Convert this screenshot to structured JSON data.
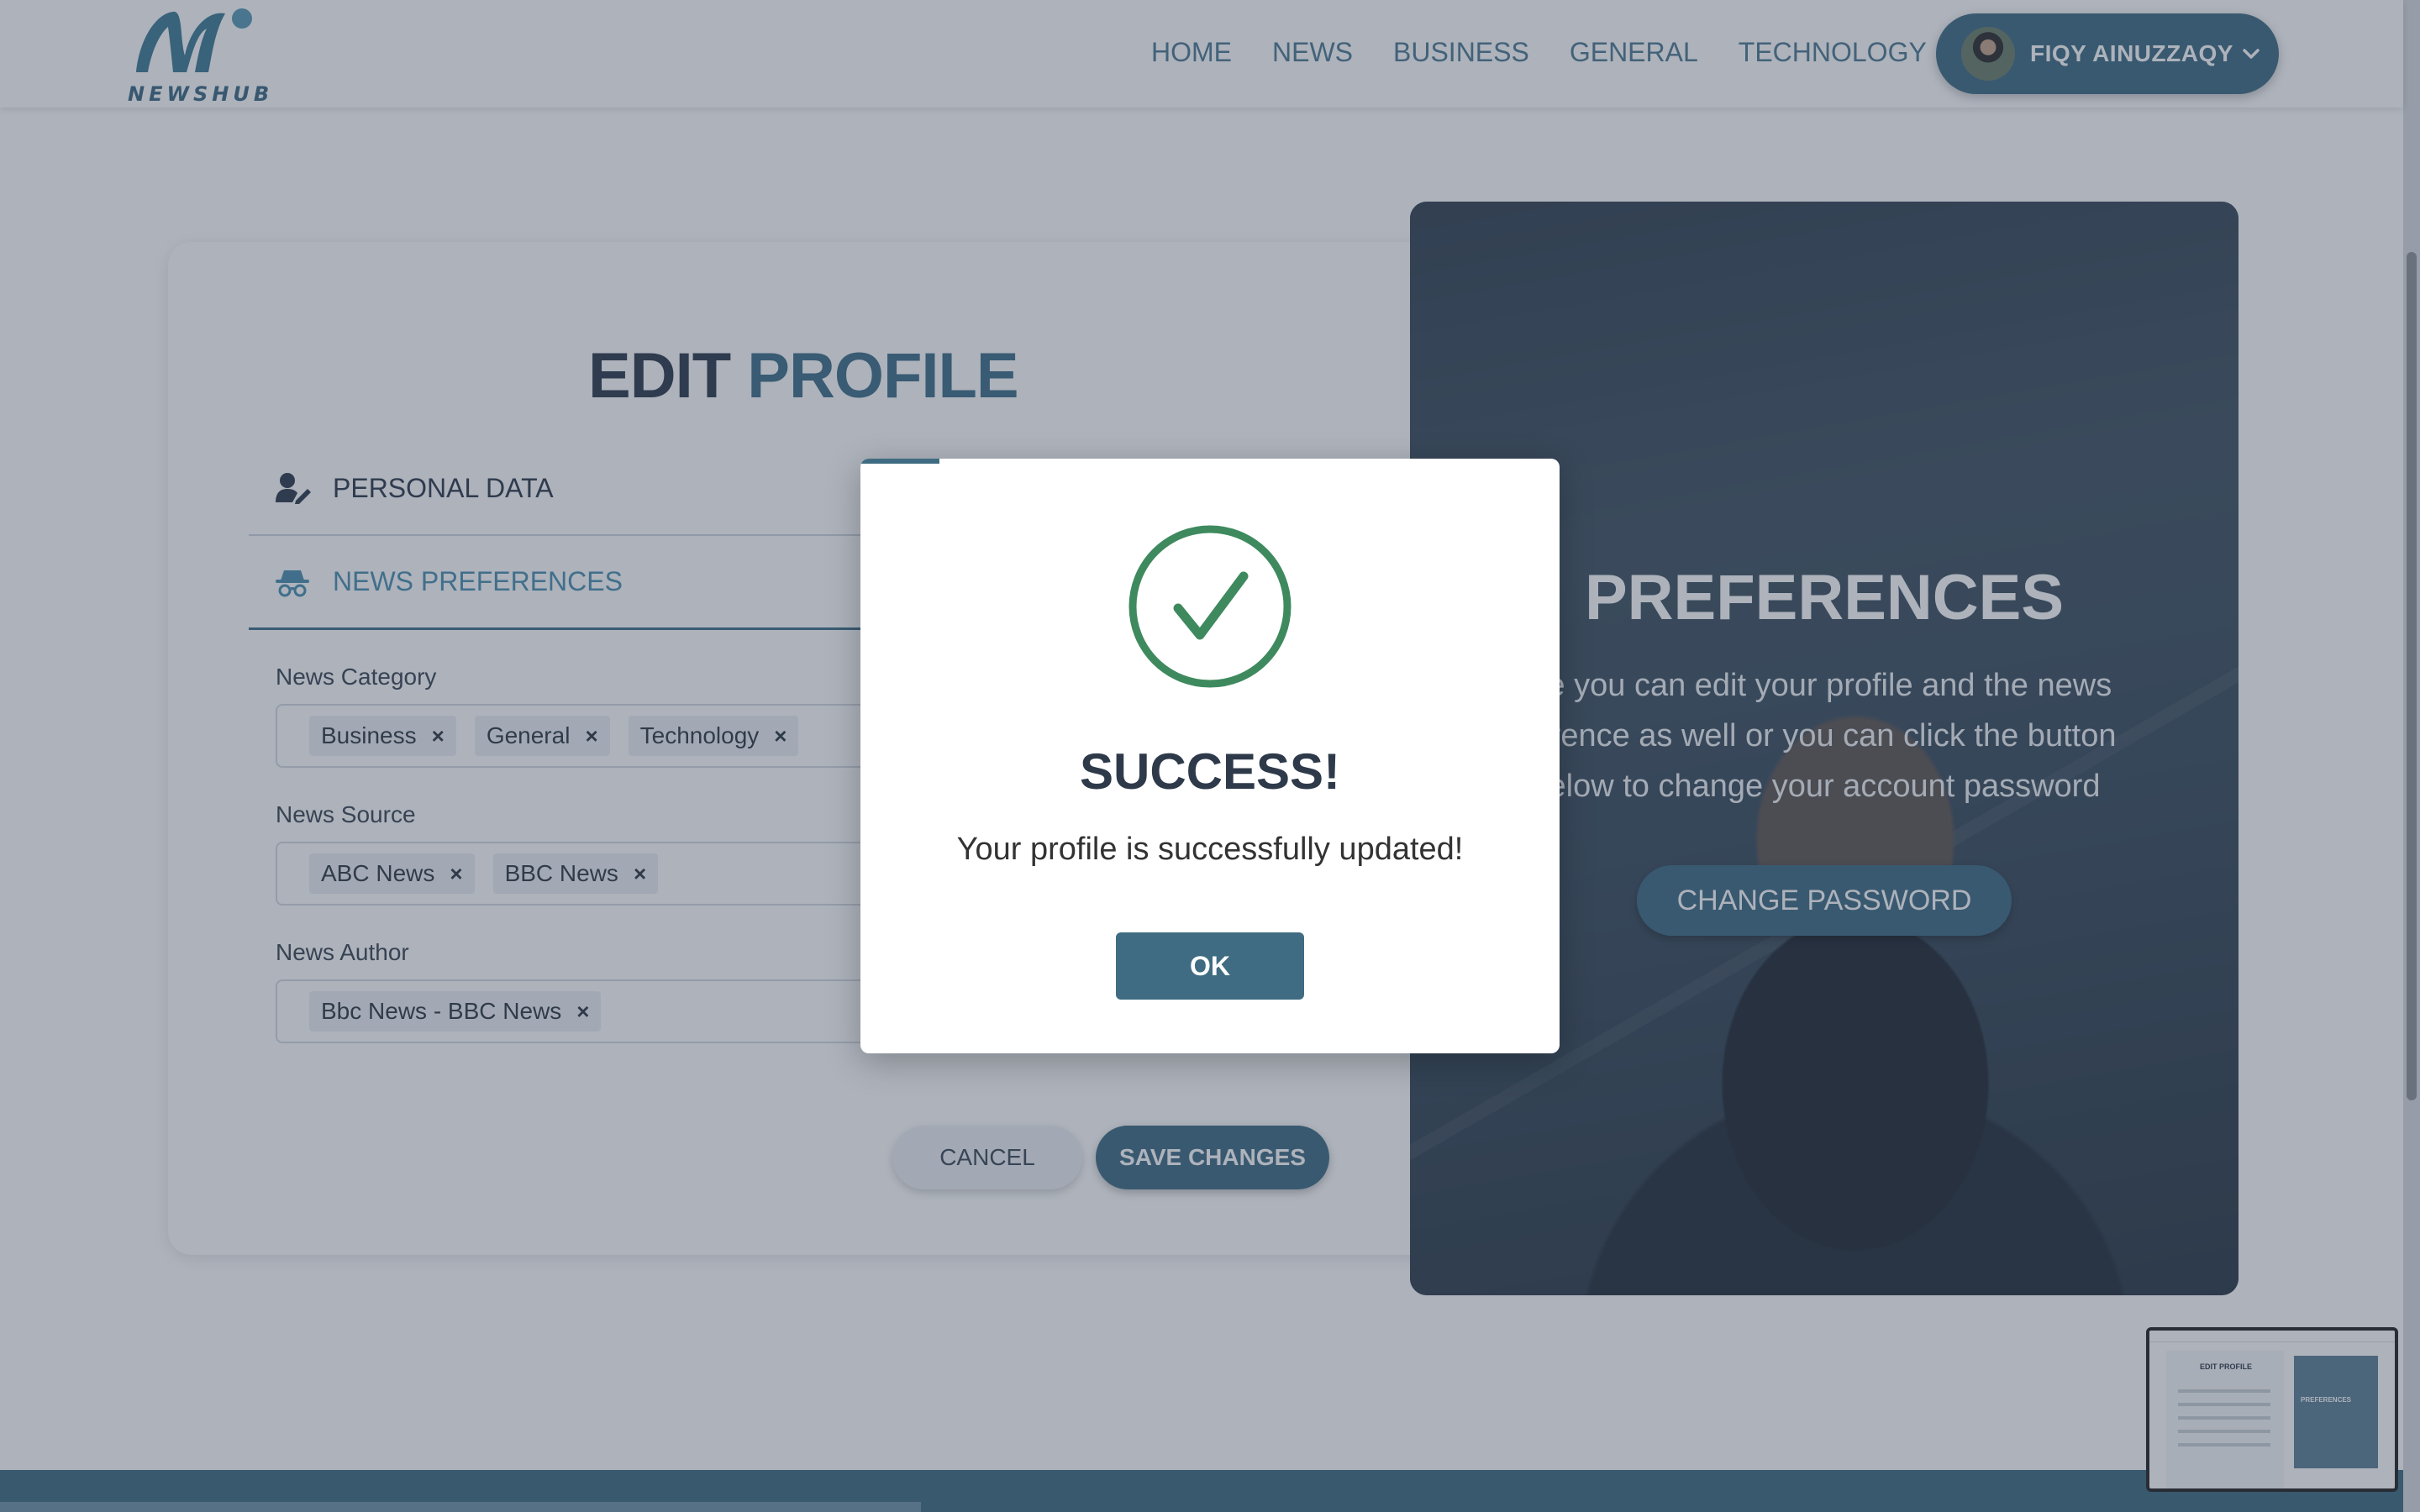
{
  "header": {
    "logo_text": "NEWSHUB",
    "nav": [
      "Home",
      "News",
      "Business",
      "General",
      "Technology"
    ],
    "user_name": "FIQY AINUZZAQY"
  },
  "main": {
    "title_part1": "EDIT",
    "title_part2": "PROFILE",
    "tabs": [
      {
        "label": "Personal Data",
        "icon": "user-edit-icon",
        "active": false
      },
      {
        "label": "News Preferences",
        "icon": "incognito-icon",
        "active": true
      }
    ],
    "fields": [
      {
        "label": "News Category",
        "chips": [
          "Business",
          "General",
          "Technology"
        ]
      },
      {
        "label": "News Source",
        "chips": [
          "ABC News",
          "BBC News"
        ]
      },
      {
        "label": "News Author",
        "chips": [
          "Bbc News - BBC News"
        ]
      }
    ],
    "cancel_label": "Cancel",
    "save_label": "Save Changes"
  },
  "panel": {
    "title": "PREFERENCES",
    "description": "re you can edit your profile and the news erence as well or you can click the button elow to change your account password",
    "button_label": "Change Password"
  },
  "modal": {
    "title": "SUCCESS!",
    "message": "Your profile is successfully updated!",
    "ok_label": "OK",
    "icon": "check-circle-icon"
  },
  "minimap": {
    "title": "EDIT PROFILE",
    "panel_title": "PREFERENCES"
  },
  "colors": {
    "brand": "#3f6c82",
    "accent": "#4b8fb0",
    "success": "#3e8a5e"
  }
}
